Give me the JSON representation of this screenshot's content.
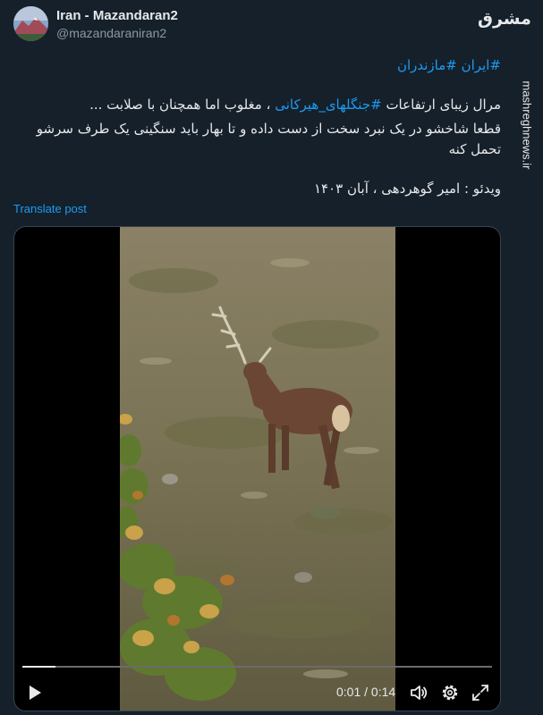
{
  "author": {
    "name": "Iran - Mazandaran2",
    "handle": "@mazandaraniran2",
    "avatar_icon": "mountain-avatar-icon"
  },
  "brand_logo": "مشرق",
  "watermark": "mashreghnews.ir",
  "tweet": {
    "hashtags": [
      "#ایران",
      "#مازندران"
    ],
    "line1_before": "مرال زیبای ارتفاعات ",
    "line1_hashtag": "#جنگلهای_هیرکانی",
    "line1_after": " ، مغلوب  اما همچنان با صلابت ...",
    "line2": "قطعا شاخشو در یک نبرد سخت از دست داده و تا بهار باید سنگینی یک طرف سرشو",
    "line3": "تحمل کنه",
    "credit": "ویدئو : امیر گوهردهی ، آبان ۱۴۰۳"
  },
  "translate_label": "Translate post",
  "video": {
    "elapsed": "0:01",
    "duration": "0:14",
    "time_separator": " / ",
    "progress": 0.07
  },
  "icons": {
    "play": "play-icon",
    "volume": "volume-icon",
    "settings": "settings-icon",
    "fullscreen": "fullscreen-icon"
  },
  "colors": {
    "background": "#15202b",
    "text": "#e7e9ea",
    "secondary_text": "#8b98a5",
    "accent": "#1d9bf0",
    "border": "#38444d"
  }
}
